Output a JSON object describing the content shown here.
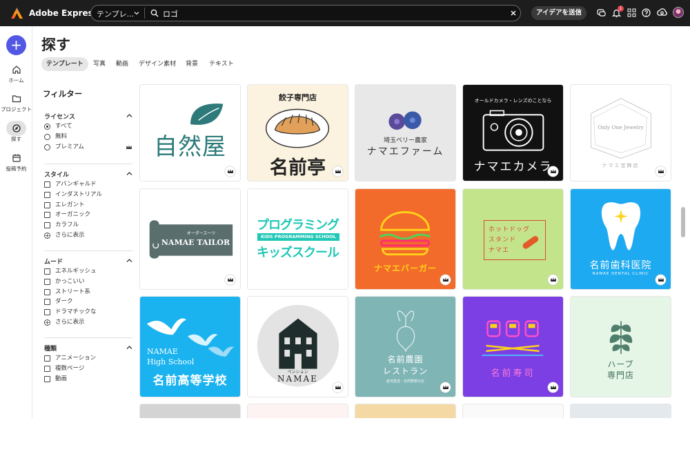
{
  "app": {
    "name": "Adobe Express"
  },
  "search": {
    "scope": "テンプレ...",
    "query": "ロゴ"
  },
  "topbar": {
    "idea_button": "アイデアを送信",
    "notification_count": "1"
  },
  "rail": {
    "create_label": "+",
    "items": [
      {
        "label": "ホーム",
        "icon": "home-icon"
      },
      {
        "label": "プロジェクト",
        "icon": "folder-icon"
      },
      {
        "label": "探す",
        "icon": "explore-icon",
        "active": true
      },
      {
        "label": "投稿予約",
        "icon": "calendar-icon"
      }
    ]
  },
  "page": {
    "title": "探す",
    "tabs": [
      "テンプレート",
      "写真",
      "動画",
      "デザイン素材",
      "背景",
      "テキスト"
    ]
  },
  "filters": {
    "title": "フィルター",
    "license": {
      "heading": "ライセンス",
      "options": [
        "すべて",
        "無料",
        "プレミアム"
      ],
      "selected": "すべて"
    },
    "style": {
      "heading": "スタイル",
      "options": [
        "アバンギャルド",
        "インダストリアル",
        "エレガント",
        "オーガニック",
        "カラフル"
      ],
      "more": "さらに表示"
    },
    "mood": {
      "heading": "ムード",
      "options": [
        "エネルギッシュ",
        "かっこいい",
        "ストリート系",
        "ダーク",
        "ドラマチックな"
      ],
      "more": "さらに表示"
    },
    "type": {
      "heading": "種類",
      "options": [
        "アニメーション",
        "複数ページ",
        "動画"
      ]
    }
  },
  "templates": {
    "row1": {
      "c1": {
        "text": "自然屋"
      },
      "c2": {
        "top": "餃子専門店",
        "main": "名前亭"
      },
      "c3": {
        "top": "埼玉ベリー農家",
        "main": "ナマエファーム"
      },
      "c4": {
        "top": "オールドカメラ・レンズのことなら",
        "main": "ナマエカメラ"
      },
      "c5": {
        "top": "Only One Jewelry",
        "main": "ナマエ宝飾店"
      }
    },
    "row2": {
      "c1": {
        "top": "オーダースーツ",
        "main": "NAMAE TAILOR"
      },
      "c2": {
        "top": "プログラミング",
        "band": "KIDS PROGRAMMING SCHOOL",
        "main": "キッズスクール"
      },
      "c3": {
        "main": "ナマエバーガー"
      },
      "c4": {
        "l1": "ホットドッグ",
        "l2": "スタンド",
        "l3": "ナマエ"
      },
      "c5": {
        "main": "名前歯科医院",
        "sub": "NAMAE DENTAL CLINIC"
      }
    },
    "row3": {
      "c1": {
        "l1": "NAMAE",
        "l2": "High School",
        "main": "名前高等学校"
      },
      "c2": {
        "top": "ペンション",
        "main": "NAMAE"
      },
      "c3": {
        "main": "名前農園",
        "l2": "レストラン",
        "sub": "産地直送・自然野菜の店"
      },
      "c4": {
        "main": "名前寿司"
      },
      "c5": {
        "l1": "ハーブ",
        "l2": "専門店"
      }
    }
  },
  "colors": {
    "accent": "#5258e4",
    "topbar": "#1d1d1d",
    "burger_bg": "#f26b2b",
    "dental_bg": "#1eaaf1",
    "school_bg": "#1ab3ef",
    "sushi_bg": "#7b3fe4",
    "farm_bg": "#7fb5b5"
  }
}
